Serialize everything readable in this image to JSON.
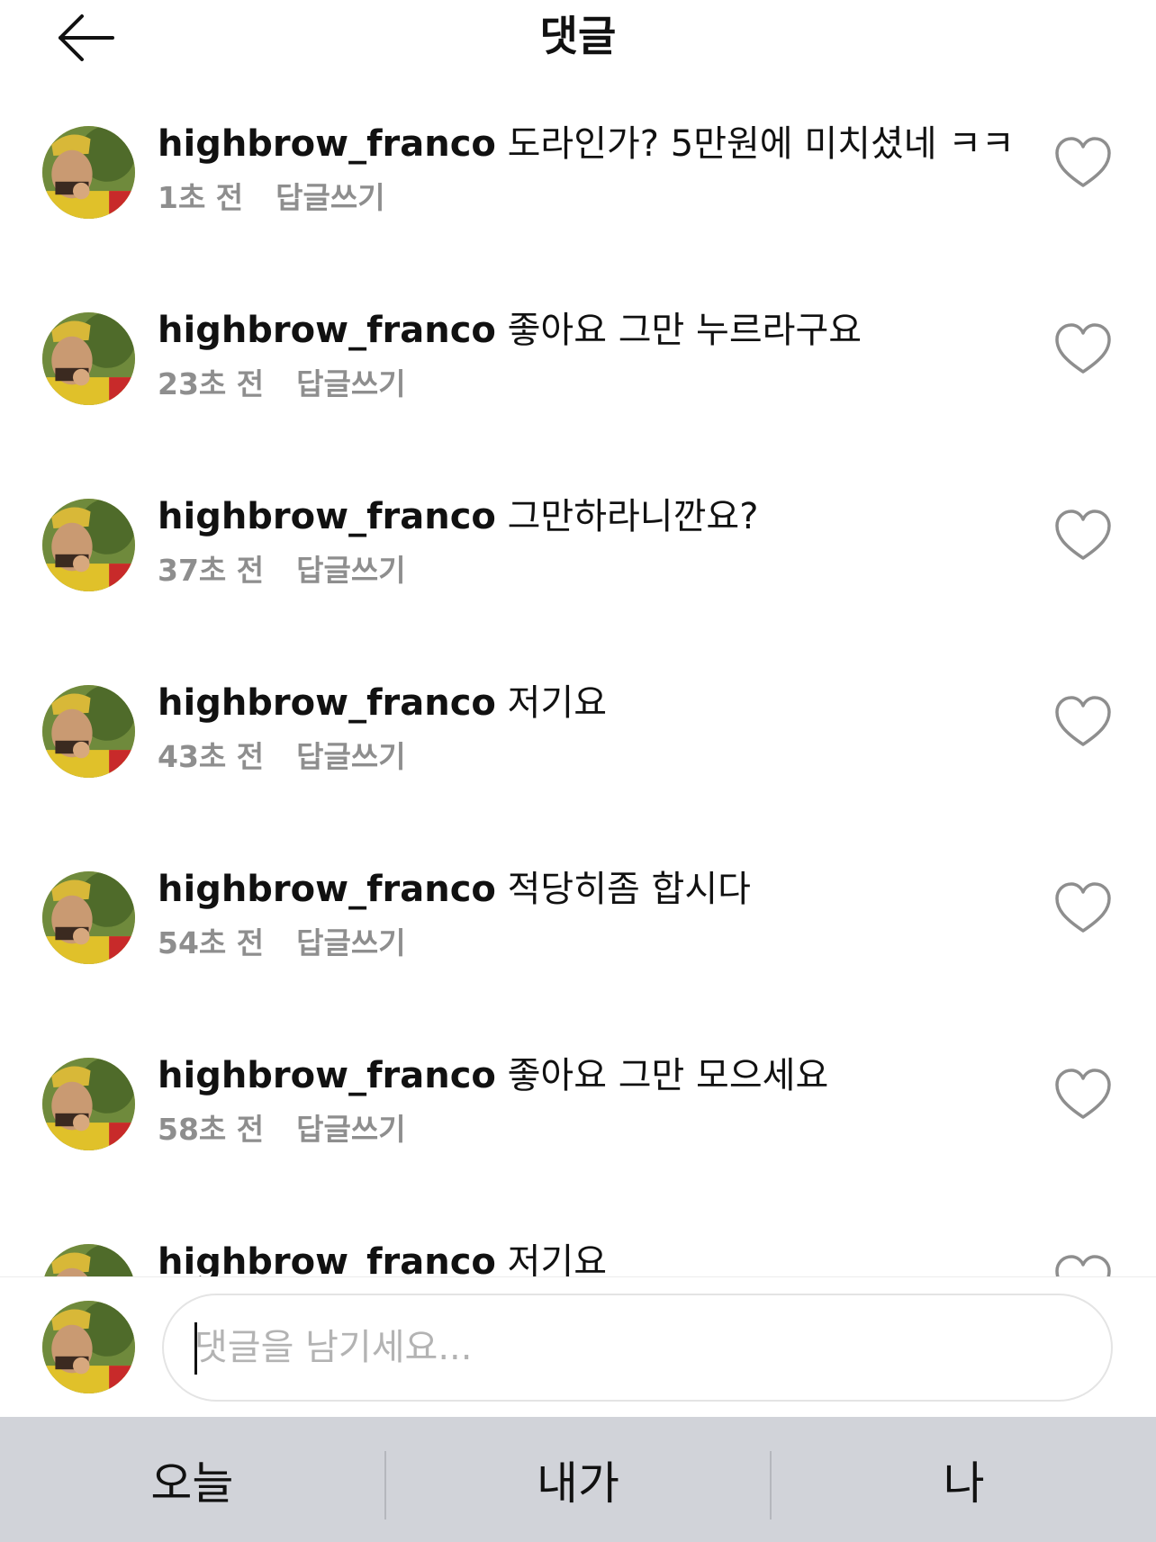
{
  "header": {
    "title": "댓글"
  },
  "comments": [
    {
      "username": "highbrow_franco",
      "text": "도라인가? 5만원에 미치셨네 ㅋㅋ",
      "time": "1초 전",
      "reply_label": "답글쓰기"
    },
    {
      "username": "highbrow_franco",
      "text": "좋아요 그만 누르라구요",
      "time": "23초 전",
      "reply_label": "답글쓰기"
    },
    {
      "username": "highbrow_franco",
      "text": "그만하라니깐요?",
      "time": "37초 전",
      "reply_label": "답글쓰기"
    },
    {
      "username": "highbrow_franco",
      "text": "저기요",
      "time": "43초 전",
      "reply_label": "답글쓰기"
    },
    {
      "username": "highbrow_franco",
      "text": "적당히좀 합시다",
      "time": "54초 전",
      "reply_label": "답글쓰기"
    },
    {
      "username": "highbrow_franco",
      "text": "좋아요 그만 모으세요",
      "time": "58초 전",
      "reply_label": "답글쓰기"
    },
    {
      "username": "highbrow_franco",
      "text": "저기요"
    }
  ],
  "input": {
    "placeholder": "댓글을 남기세요..."
  },
  "keyboard_suggestions": [
    "오늘",
    "내가",
    "나"
  ],
  "icons": {
    "back": "arrow-left-icon",
    "like": "heart-outline-icon"
  }
}
